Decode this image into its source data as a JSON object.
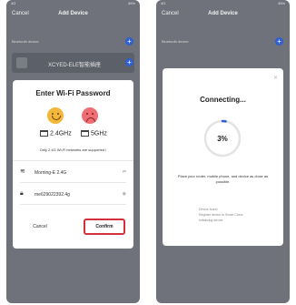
{
  "left": {
    "status": {
      "left": "4G",
      "right": "45%"
    },
    "nav": {
      "cancel": "Cancel",
      "title": "Add Device"
    },
    "section_label": "Bluetooth device",
    "device_name": "XCYED-ELE智能插座",
    "wifi_dialog": {
      "title": "Enter Wi-Fi Password",
      "band_24": "2.4GHz",
      "band_5": "5GHz",
      "note": "Only 2.4G Wi-Fi networks are supported !",
      "ssid": "Morning-E 2.4G",
      "password": "me629022392.4g",
      "cancel": "Cancel",
      "confirm": "Confirm"
    }
  },
  "right": {
    "status": {
      "left": "4G",
      "right": "45%"
    },
    "nav": {
      "cancel": "Cancel",
      "title": "Add Device"
    },
    "section_label": "Bluetooth device",
    "connect_dialog": {
      "title": "Connecting...",
      "progress_percent": 3,
      "progress_label": "3%",
      "hint": "Place your router, mobile phone, and device as close as possible.",
      "steps": [
        "Device found",
        "Register device to Smart Cloud",
        "Initializing device"
      ]
    }
  },
  "colors": {
    "accent": "#2f5fcf",
    "confirm_border": "#d2303a",
    "overlay": "#6f727a"
  }
}
